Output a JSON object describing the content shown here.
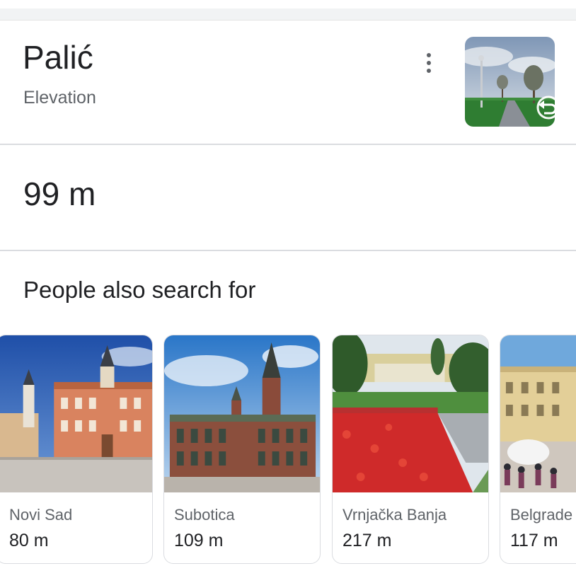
{
  "place": {
    "title": "Palić",
    "subtitle": "Elevation",
    "value": "99 m",
    "thumbnail_icon": "street-view-pano-icon",
    "menu_icon": "more-vert-icon"
  },
  "related": {
    "heading": "People also search for",
    "items": [
      {
        "name": "Novi Sad",
        "elevation": "80 m",
        "image": "novi-sad-city-hall-photo"
      },
      {
        "name": "Subotica",
        "elevation": "109 m",
        "image": "subotica-city-hall-photo"
      },
      {
        "name": "Vrnjačka Banja",
        "elevation": "217 m",
        "image": "vrnjacka-banja-park-photo"
      },
      {
        "name": "Belgrade",
        "elevation": "117 m",
        "image": "belgrade-street-photo"
      }
    ]
  },
  "colors": {
    "text_primary": "#202124",
    "text_secondary": "#5f6368",
    "divider": "#dadce0",
    "top_band": "#f1f3f4"
  }
}
